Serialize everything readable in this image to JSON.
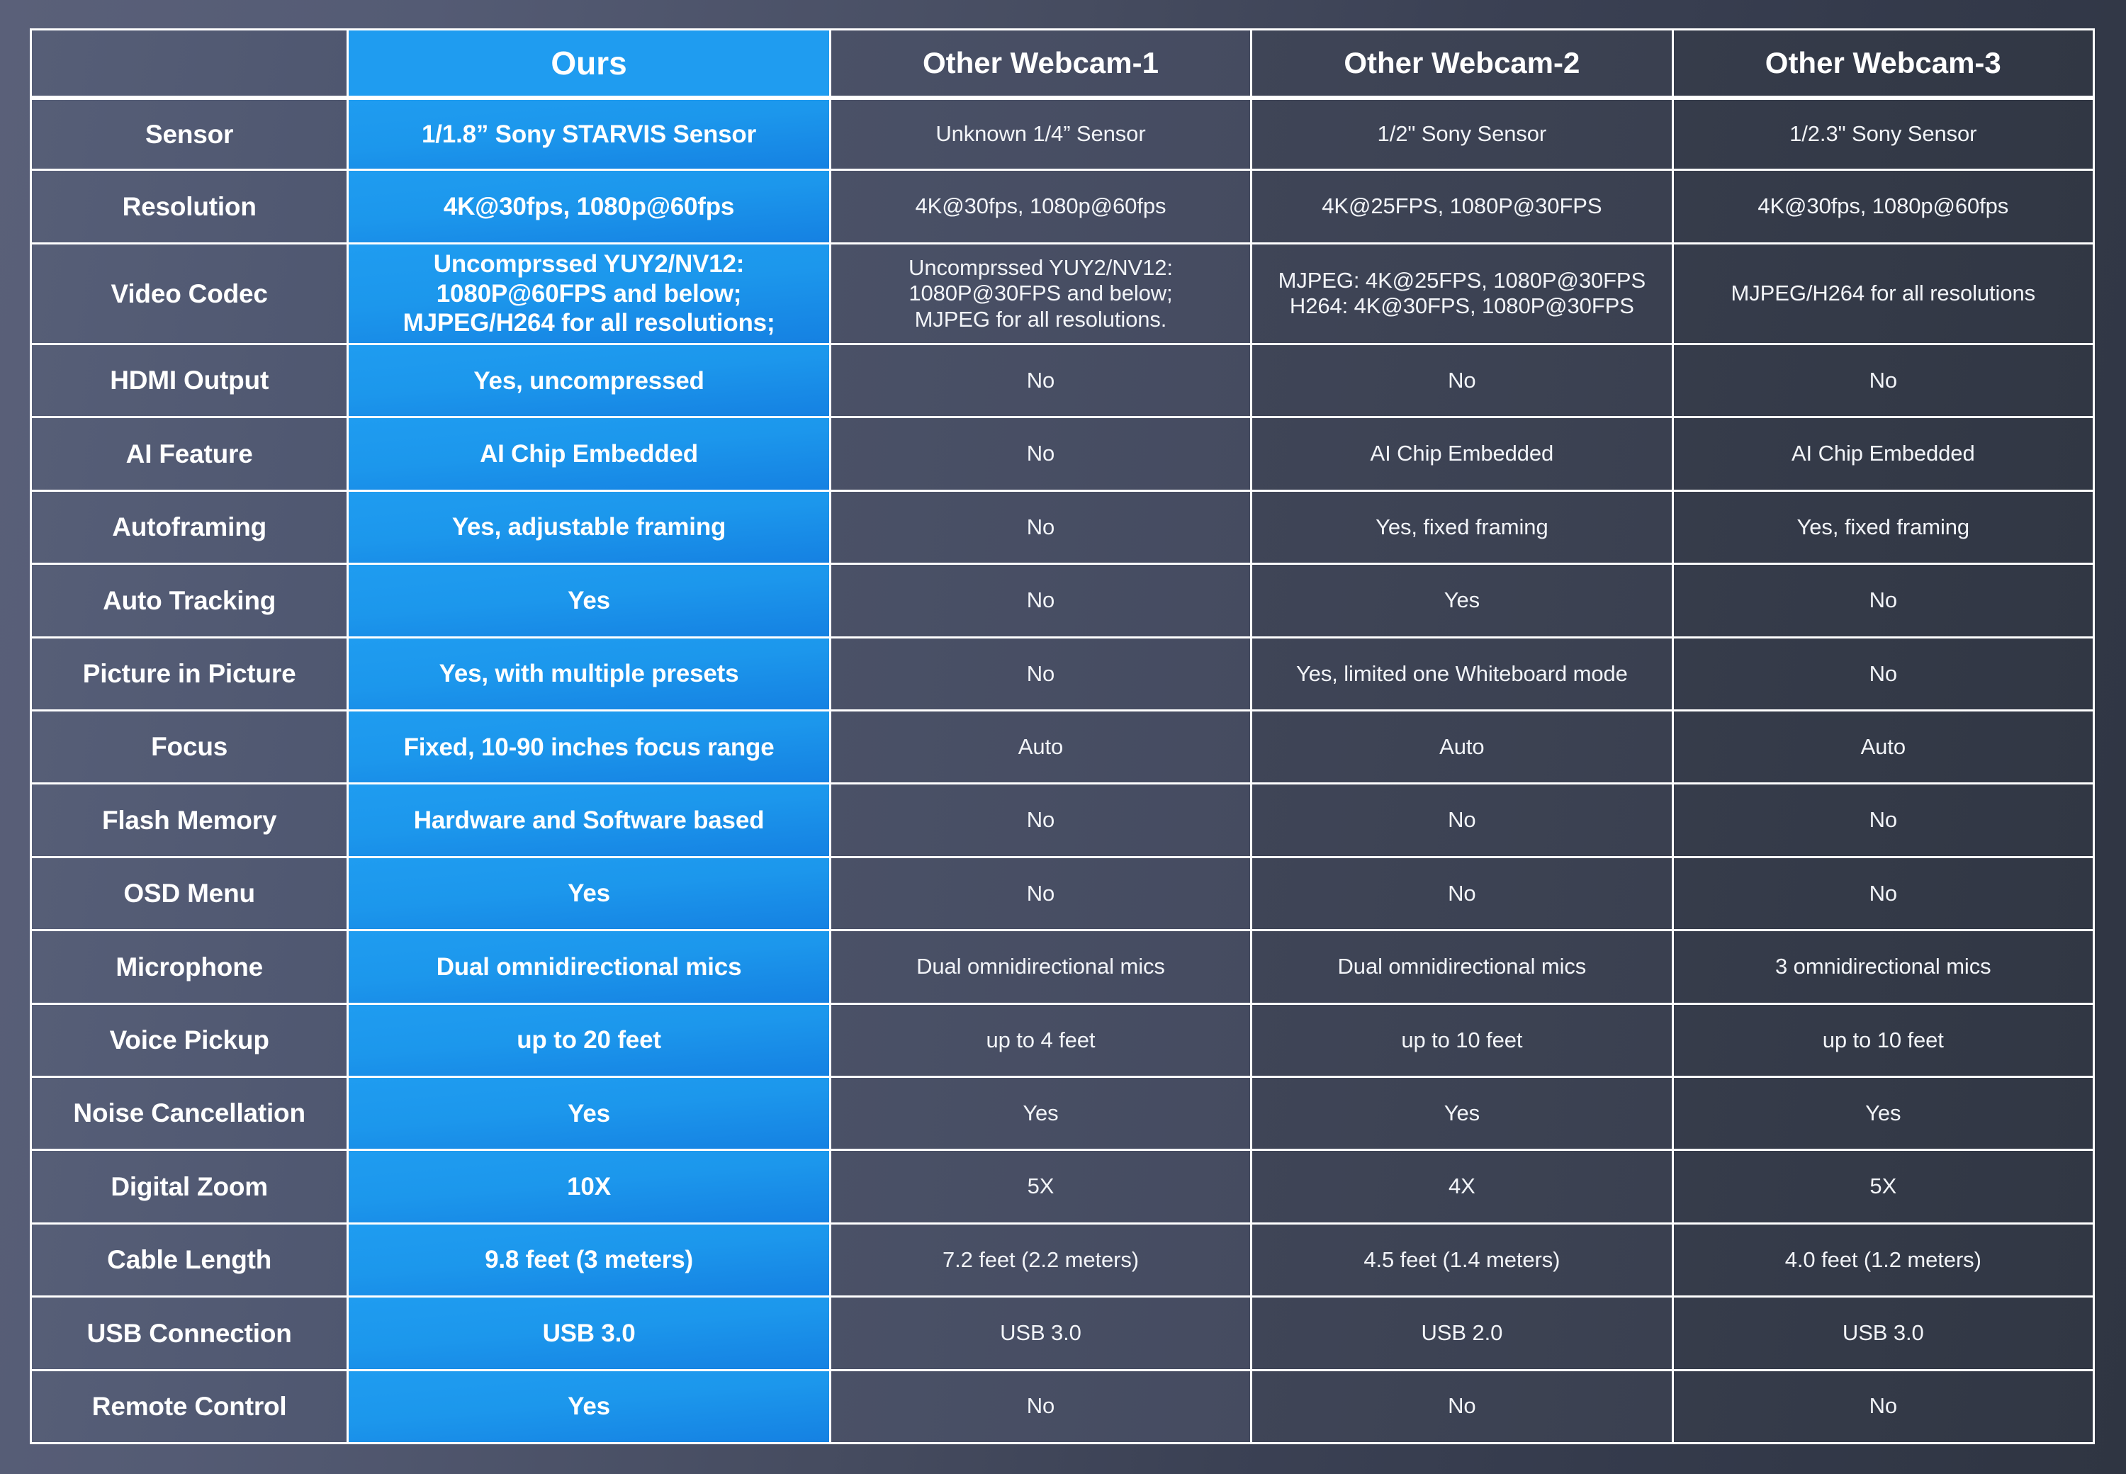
{
  "theme": {
    "accent_blue": "#1f9cf0",
    "panel_dark": "#4a5167",
    "background_dark": "#2f3542",
    "grid_line": "#ffffff",
    "text_light": "#ffffff"
  },
  "table": {
    "columns": [
      {
        "key": "feature",
        "label": ""
      },
      {
        "key": "ours",
        "label": "Ours",
        "highlight": true
      },
      {
        "key": "w1",
        "label": "Other Webcam-1",
        "highlight": false
      },
      {
        "key": "w2",
        "label": "Other Webcam-2",
        "highlight": false
      },
      {
        "key": "w3",
        "label": "Other Webcam-3",
        "highlight": false
      }
    ],
    "rows": [
      {
        "feature": "Sensor",
        "ours": "1/1.8” Sony STARVIS Sensor",
        "w1": "Unknown  1/4” Sensor",
        "w2": "1/2\" Sony Sensor",
        "w3": "1/2.3\" Sony Sensor"
      },
      {
        "feature": "Resolution",
        "ours": "4K@30fps, 1080p@60fps",
        "w1": "4K@30fps, 1080p@60fps",
        "w2": "4K@25FPS, 1080P@30FPS",
        "w3": "4K@30fps, 1080p@60fps"
      },
      {
        "feature": "Video Codec",
        "ours": "Uncomprssed YUY2/NV12:\n1080P@60FPS and below;\nMJPEG/H264 for all resolutions;",
        "w1": "Uncomprssed YUY2/NV12:\n1080P@30FPS and below;\nMJPEG for all resolutions.",
        "w2": "MJPEG: 4K@25FPS, 1080P@30FPS\nH264: 4K@30FPS, 1080P@30FPS",
        "w3": "MJPEG/H264 for all resolutions",
        "tall": true
      },
      {
        "feature": "HDMI Output",
        "ours": "Yes, uncompressed",
        "w1": "No",
        "w2": "No",
        "w3": "No"
      },
      {
        "feature": "AI Feature",
        "ours": "AI Chip Embedded",
        "w1": "No",
        "w2": "AI Chip Embedded",
        "w3": "AI Chip Embedded"
      },
      {
        "feature": "Autoframing",
        "ours": "Yes, adjustable framing",
        "w1": "No",
        "w2": "Yes, fixed framing",
        "w3": "Yes, fixed framing"
      },
      {
        "feature": "Auto Tracking",
        "ours": "Yes",
        "w1": "No",
        "w2": "Yes",
        "w3": "No"
      },
      {
        "feature": "Picture in Picture",
        "ours": "Yes, with multiple presets",
        "w1": "No",
        "w2": "Yes, limited one Whiteboard mode",
        "w3": "No"
      },
      {
        "feature": "Focus",
        "ours": "Fixed, 10-90 inches focus range",
        "w1": "Auto",
        "w2": "Auto",
        "w3": "Auto"
      },
      {
        "feature": "Flash Memory",
        "ours": "Hardware and Software based",
        "w1": "No",
        "w2": "No",
        "w3": "No"
      },
      {
        "feature": "OSD Menu",
        "ours": "Yes",
        "w1": "No",
        "w2": "No",
        "w3": "No"
      },
      {
        "feature": "Microphone",
        "ours": "Dual omnidirectional mics",
        "w1": "Dual omnidirectional mics",
        "w2": "Dual omnidirectional mics",
        "w3": "3 omnidirectional mics"
      },
      {
        "feature": "Voice Pickup",
        "ours": "up to 20 feet",
        "w1": "up to 4 feet",
        "w2": "up to 10 feet",
        "w3": "up to 10 feet"
      },
      {
        "feature": "Noise Cancellation",
        "ours": "Yes",
        "w1": "Yes",
        "w2": "Yes",
        "w3": "Yes"
      },
      {
        "feature": "Digital Zoom",
        "ours": "10X",
        "w1": "5X",
        "w2": "4X",
        "w3": "5X"
      },
      {
        "feature": "Cable Length",
        "ours": "9.8 feet (3 meters)",
        "w1": "7.2 feet (2.2 meters)",
        "w2": "4.5 feet (1.4 meters)",
        "w3": "4.0 feet (1.2 meters)"
      },
      {
        "feature": "USB Connection",
        "ours": "USB 3.0",
        "w1": "USB 3.0",
        "w2": "USB 2.0",
        "w3": "USB 3.0"
      },
      {
        "feature": "Remote Control",
        "ours": "Yes",
        "w1": "No",
        "w2": "No",
        "w3": "No"
      }
    ]
  }
}
